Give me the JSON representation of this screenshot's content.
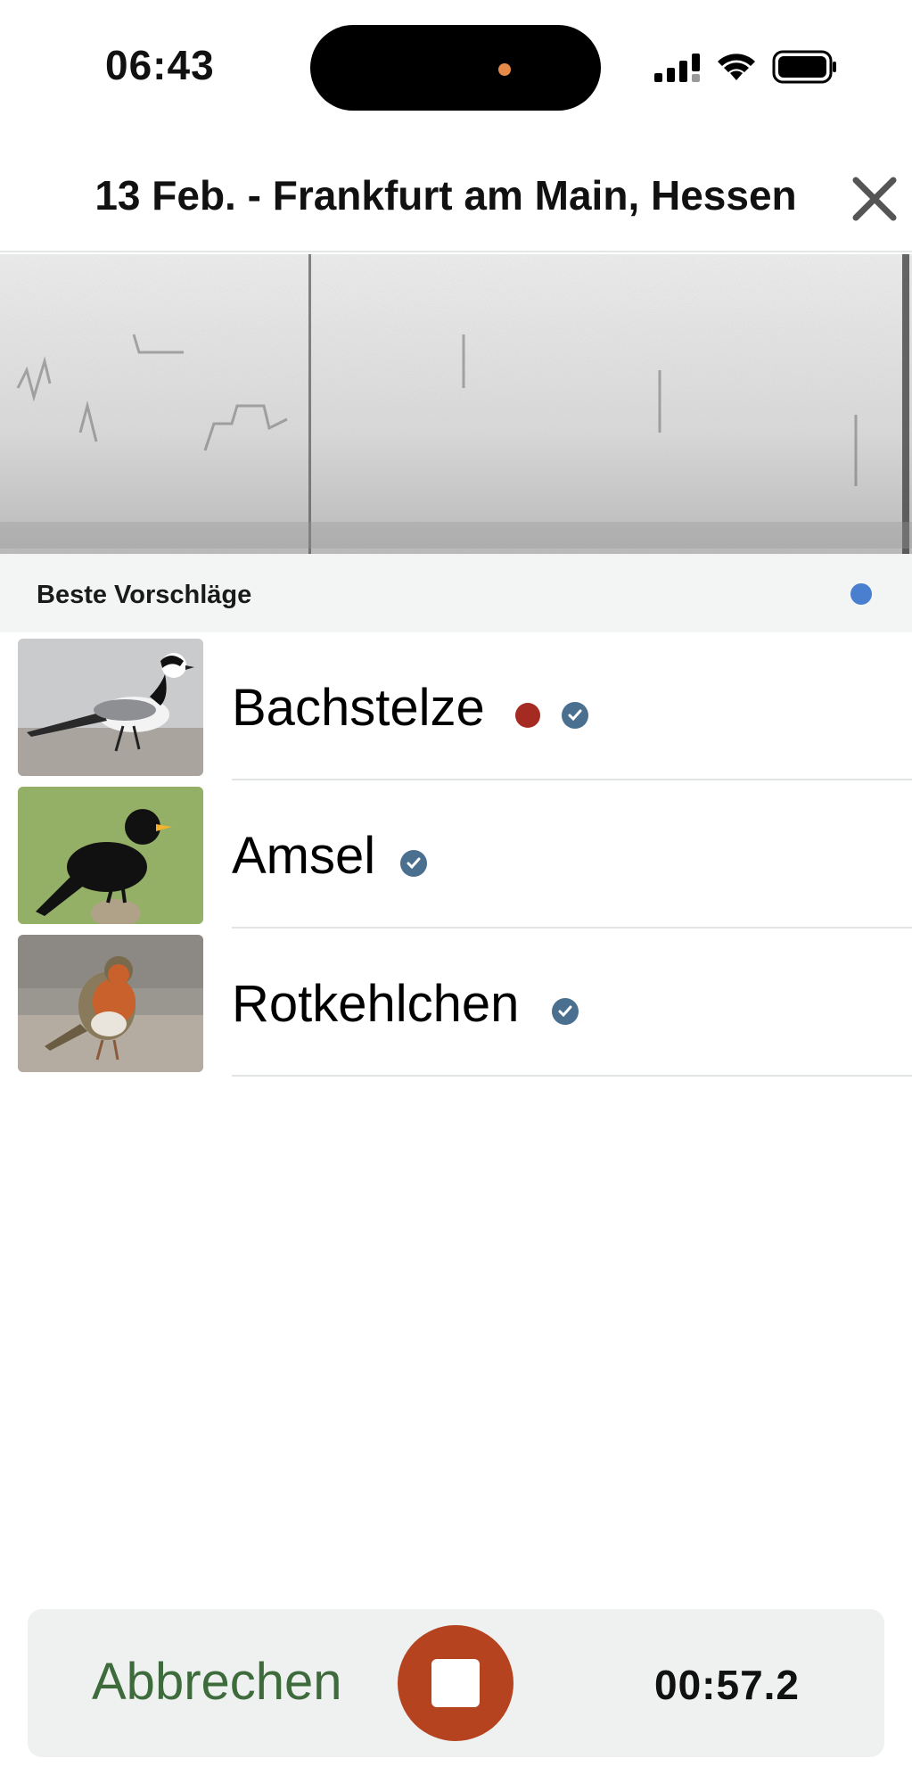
{
  "status_bar": {
    "time": "06:43"
  },
  "header": {
    "title": "13 Feb. - Frankfurt am Main, Hessen",
    "close_icon": "close-icon"
  },
  "suggestions": {
    "label": "Beste Vorschläge",
    "indicator_color": "#4a7fd0"
  },
  "species": [
    {
      "name": "Bachstelze",
      "has_red_dot": true,
      "verified": true
    },
    {
      "name": "Amsel",
      "has_red_dot": false,
      "verified": true
    },
    {
      "name": "Rotkehlchen",
      "has_red_dot": false,
      "verified": true
    }
  ],
  "bottom_bar": {
    "cancel_label": "Abbrechen",
    "timer": "00:57.2",
    "record_button_color": "#b5431f"
  }
}
